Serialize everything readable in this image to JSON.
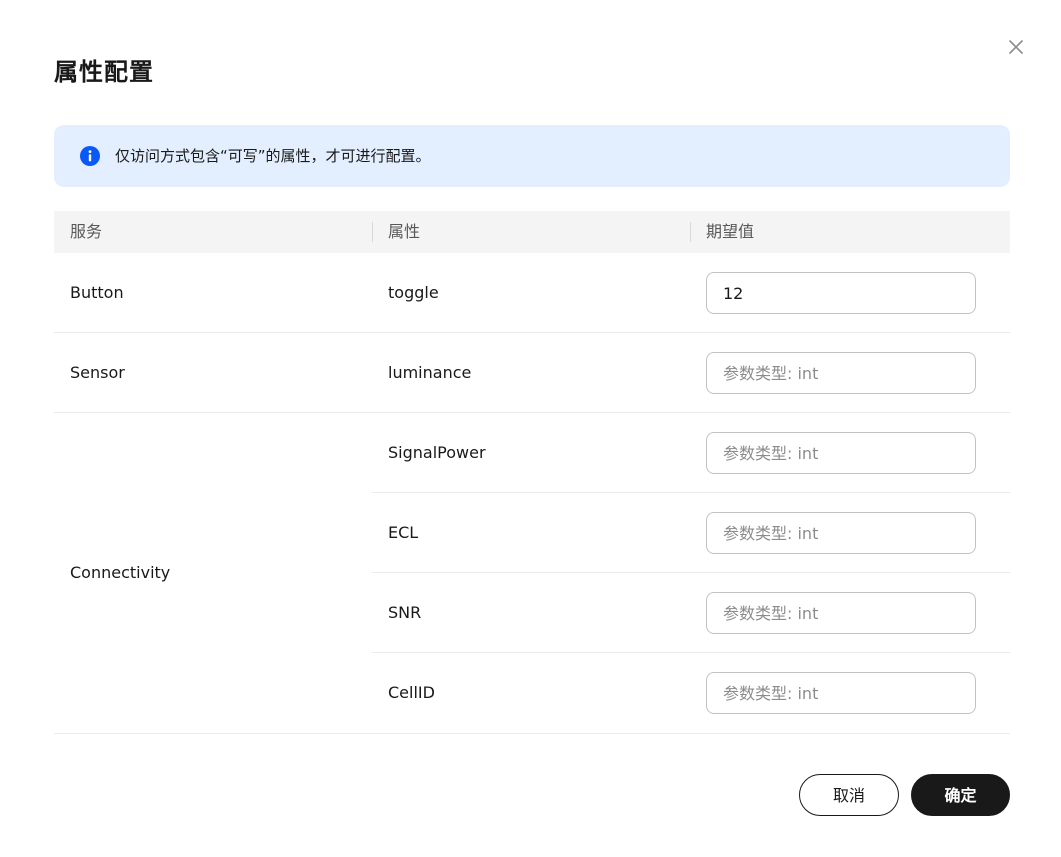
{
  "dialog": {
    "title": "属性配置",
    "notice": "仅访问方式包含“可写”的属性，才可进行配置。",
    "colors": {
      "notice_bg": "#e3eefe",
      "info_icon": "#0a59f7",
      "primary_button": "#191919"
    }
  },
  "table": {
    "headers": [
      "服务",
      "属性",
      "期望值"
    ],
    "rows": [
      {
        "service": "Button",
        "property": "toggle",
        "value": "12",
        "placeholder": "参数类型: int"
      },
      {
        "service": "Sensor",
        "property": "luminance",
        "value": "",
        "placeholder": "参数类型: int"
      }
    ],
    "group": {
      "service": "Connectivity",
      "items": [
        {
          "property": "SignalPower",
          "value": "",
          "placeholder": "参数类型: int"
        },
        {
          "property": "ECL",
          "value": "",
          "placeholder": "参数类型: int"
        },
        {
          "property": "SNR",
          "value": "",
          "placeholder": "参数类型: int"
        },
        {
          "property": "CellID",
          "value": "",
          "placeholder": "参数类型: int"
        }
      ]
    }
  },
  "footer": {
    "cancel_label": "取消",
    "ok_label": "确定"
  },
  "icons": {
    "close": "close-icon",
    "info": "info-icon"
  }
}
